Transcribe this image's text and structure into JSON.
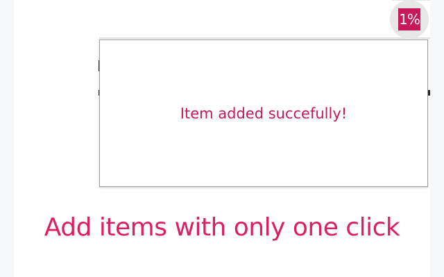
{
  "extension": {
    "icon_label": "1%",
    "icon_name": "one-percent-icon"
  },
  "popup": {
    "message": "Item added succefully!"
  },
  "tagline": "Add items with only one click",
  "colors": {
    "accent": "#c8185c",
    "tagline": "#dc1f5e",
    "background": "#f7f8fc"
  }
}
